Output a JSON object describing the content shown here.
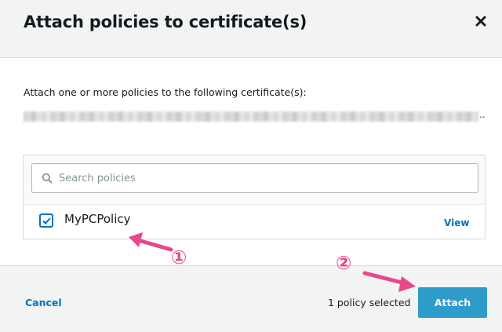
{
  "dialog": {
    "title": "Attach policies to certificate(s)",
    "close_icon": "close-icon"
  },
  "body": {
    "description": "Attach one or more policies to the following certificate(s):",
    "certificate_redacted": "blurred-certificate-id",
    "ellipsis": ".."
  },
  "search": {
    "placeholder": "Search policies",
    "value": "",
    "icon": "search-icon"
  },
  "policies": [
    {
      "name": "MyPCPolicy",
      "checked": true,
      "action_label": "View"
    }
  ],
  "footer": {
    "cancel_label": "Cancel",
    "selected_text": "1 policy selected",
    "attach_label": "Attach"
  },
  "annotations": {
    "marker_1": "①",
    "marker_2": "②",
    "arrow_color": "#e8488a"
  },
  "colors": {
    "accent": "#0073bb",
    "primary_button": "#2f9bc9",
    "header_bg": "#f2f3f3"
  }
}
